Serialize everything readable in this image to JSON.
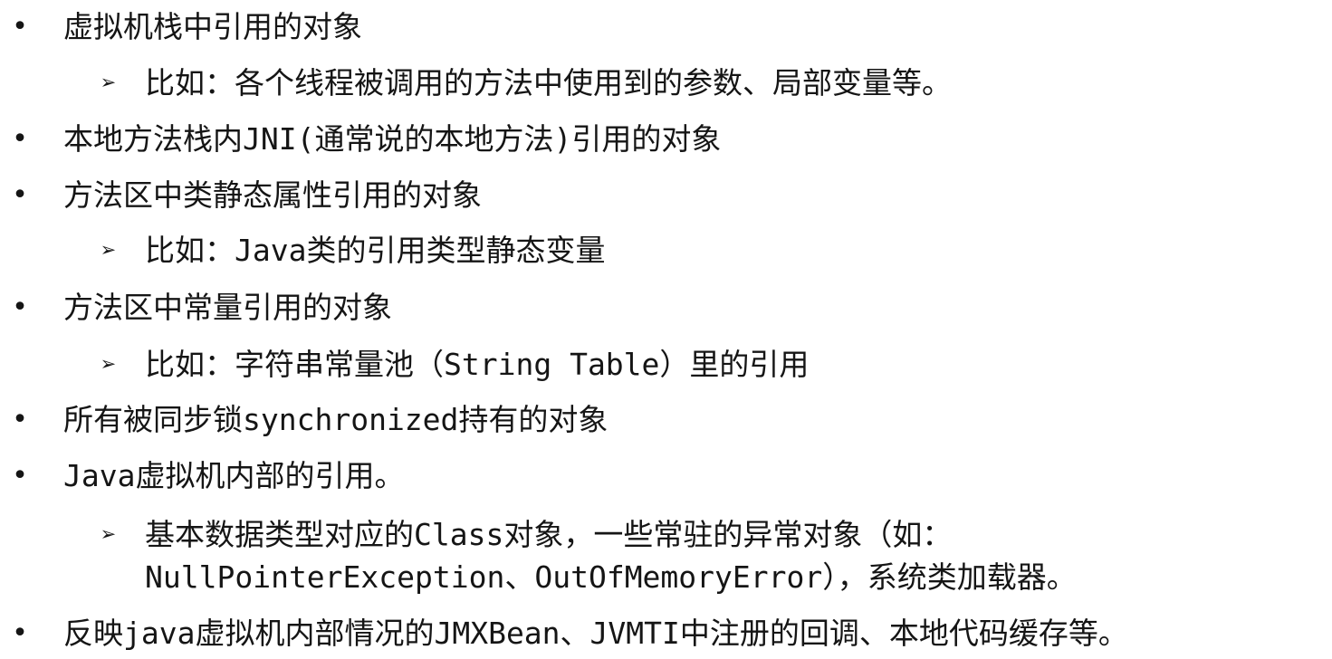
{
  "items": [
    {
      "text": "虚拟机栈中引用的对象",
      "children": [
        "比如：各个线程被调用的方法中使用到的参数、局部变量等。"
      ]
    },
    {
      "text": "本地方法栈内JNI(通常说的本地方法)引用的对象",
      "children": []
    },
    {
      "text": "方法区中类静态属性引用的对象",
      "children": [
        "比如：Java类的引用类型静态变量"
      ]
    },
    {
      "text": "方法区中常量引用的对象",
      "children": [
        "比如：字符串常量池（String Table）里的引用"
      ]
    },
    {
      "text": "所有被同步锁synchronized持有的对象",
      "children": []
    },
    {
      "text": "Java虚拟机内部的引用。",
      "children": [
        "基本数据类型对应的Class对象，一些常驻的异常对象（如：",
        "NullPointerException、OutOfMemoryError），系统类加载器。"
      ]
    },
    {
      "text": "反映java虚拟机内部情况的JMXBean、JVMTI中注册的回调、本地代码缓存等。",
      "children": []
    }
  ],
  "markers": {
    "bullet": "•",
    "arrow": "➢"
  }
}
